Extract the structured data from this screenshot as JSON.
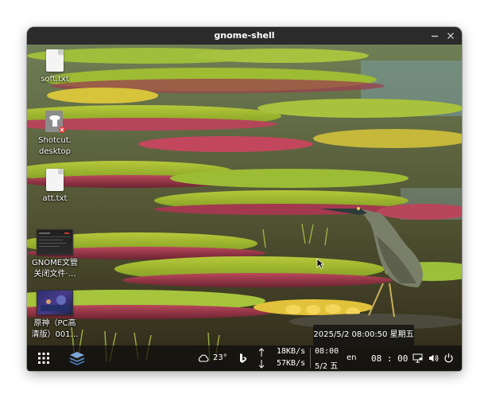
{
  "window": {
    "title": "gnome-shell"
  },
  "desktop_icons": [
    {
      "label": "soft.txt",
      "kind": "text-file"
    },
    {
      "label": "Shotcut.\ndesktop",
      "kind": "desktop-launcher"
    },
    {
      "label": "att.txt",
      "kind": "text-file"
    },
    {
      "label": "GNOME文管\n关闭文件·…",
      "kind": "screenshot-thumbnail"
    },
    {
      "label": "原神（PC高\n清版）001…",
      "kind": "screenshot-thumbnail"
    }
  ],
  "tooltip": {
    "text": "2025/5/2 08:00:50 星期五"
  },
  "panel": {
    "weather_temp": "23°",
    "net_up": "18KB/s",
    "net_down": "57KB/s",
    "clock_time_small": "08:00",
    "clock_date_small": "5/2 五",
    "input_method": "en",
    "clock_time": "08 : 00"
  },
  "colors": {
    "titlebar": "#2b2b2b",
    "panel": "#0c0c0c"
  }
}
